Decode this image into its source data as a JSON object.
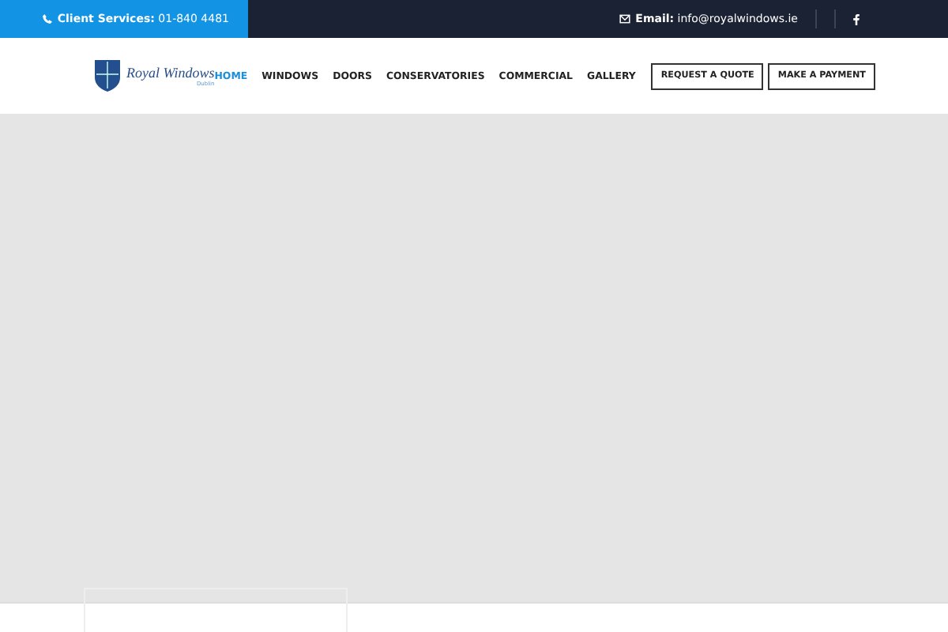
{
  "top_bar": {
    "phone_label": "Client Services:",
    "phone": "01-840 4481",
    "email_label": "Email:",
    "email": "info@royalwindows.ie"
  },
  "logo": {
    "name": "Royal Windows",
    "tagline": "Dublin"
  },
  "nav": [
    {
      "label": "HOME",
      "selected": true
    },
    {
      "label": "WINDOWS",
      "selected": false
    },
    {
      "label": "DOORS",
      "selected": false
    },
    {
      "label": "CONSERVATORIES",
      "selected": false
    },
    {
      "label": "COMMERCIAL",
      "selected": false
    },
    {
      "label": "GALLERY",
      "selected": false
    }
  ],
  "buttons": [
    "REQUEST A QUOTE",
    "MAKE A PAYMENT"
  ]
}
